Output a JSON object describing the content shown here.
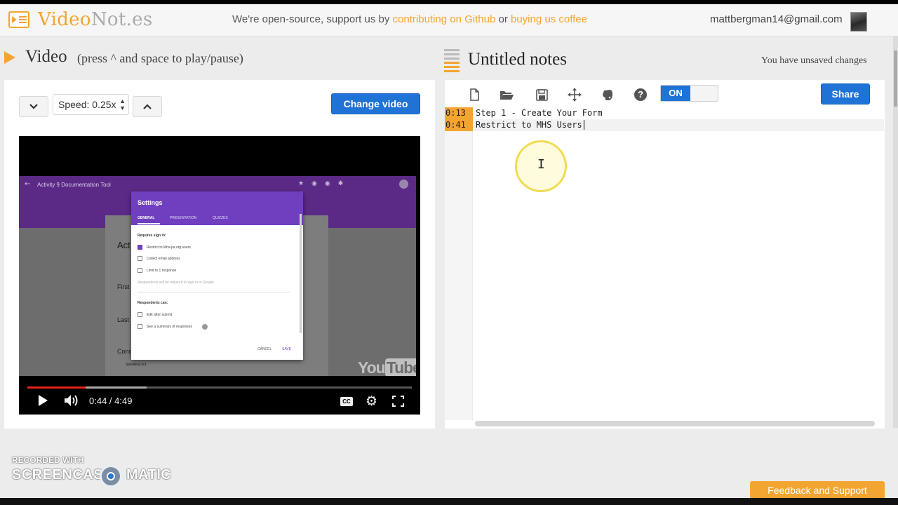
{
  "header": {
    "logo_prefix": "Video",
    "logo_suffix": "Not.es",
    "promo_text": "We're open-source, support us by",
    "promo_link_github": "contributing on Github",
    "promo_or": "or",
    "promo_link_coffee": "buying us coffee",
    "account_email": "mattbergman14@gmail.com"
  },
  "video_section": {
    "title": "Video",
    "hint": "(press ^ and space to play/pause)",
    "speed_label": "Speed: 0.25x",
    "change_video_label": "Change video"
  },
  "player": {
    "doc_title": "Activity 9 Documentation Tool",
    "settings_title": "Settings",
    "tab_general": "GENERAL",
    "tab_presentation": "PRESENTATION",
    "tab_quizzes": "QUIZZES",
    "requires_sign_in": "Requires sign in:",
    "option_restrict": "Restrict to Mhs-pa.org users",
    "option_collect_email": "Collect email address",
    "option_limit": "Limit to 1 response",
    "sign_in_note": "Respondents will be required to sign in to Google",
    "respondents_can": "Respondents can:",
    "option_edit": "Edit after submit",
    "option_summary": "See a summary of responses",
    "cancel": "CANCEL",
    "save": "SAVE",
    "bg_act": "Act",
    "bg_first": "First",
    "bg_last": "Last",
    "bg_conc": "Conc",
    "bg_speaking": "Speaking out",
    "watermark_you": "You",
    "watermark_tube": "Tube",
    "time_display": "0:44 / 4:49",
    "cc_label": "CC",
    "progress_fraction": 0.152,
    "buffered_fraction": 0.31
  },
  "notes_section": {
    "title": "Untitled notes",
    "unsaved_text": "You have unsaved changes",
    "toggle_label": "ON",
    "share_label": "Share",
    "lines": [
      {
        "timestamp": "0:13",
        "text": "Step 1 - Create Your Form"
      },
      {
        "timestamp": "0:41",
        "text": "Restrict to MHS Users"
      }
    ]
  },
  "overlay": {
    "recorded_with": "RECORDED WITH",
    "screencast_part1": "SCREENCAST",
    "screencast_part2": "MATIC",
    "feedback_label": "Feedback and Support"
  },
  "icons": {
    "new_file": "file-icon",
    "open": "folder-open-icon",
    "save": "save-icon",
    "sync": "move-icon",
    "evernote": "evernote-icon",
    "help": "help-icon"
  },
  "colors": {
    "accent_orange": "#f3a531",
    "primary_blue": "#1f73d7",
    "youtube_red": "#e62117",
    "form_purple": "#6f3fc0"
  }
}
